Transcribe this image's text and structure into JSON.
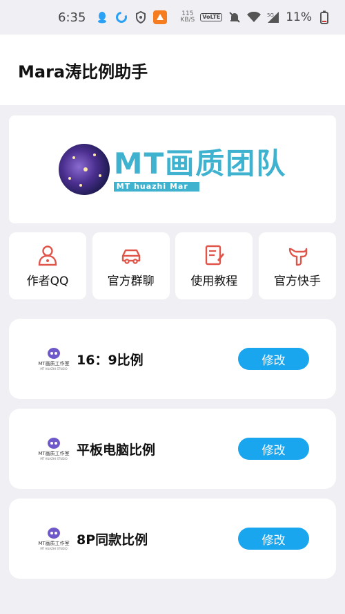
{
  "status_bar": {
    "time": "6:35",
    "net_speed_value": "115",
    "net_speed_unit": "KB/S",
    "volte_label": "VoLTE",
    "network_label": "5G",
    "battery": "11%"
  },
  "header": {
    "title": "Mara涛比例助手"
  },
  "banner": {
    "brand": "MT画质团队",
    "subtitle": "MT huazhi Mar"
  },
  "actions": [
    {
      "label": "作者QQ",
      "icon": "user-icon"
    },
    {
      "label": "官方群聊",
      "icon": "car-icon"
    },
    {
      "label": "使用教程",
      "icon": "document-icon"
    },
    {
      "label": "官方快手",
      "icon": "kuaishou-icon"
    }
  ],
  "cards": [
    {
      "title": "16：9比例",
      "button": "修改",
      "studio_name": "MT画质工作室",
      "studio_tagline": "MT HUAZHI STUDIO"
    },
    {
      "title": "平板电脑比例",
      "button": "修改",
      "studio_name": "MT画质工作室",
      "studio_tagline": "MT HUAZHI STUDIO"
    },
    {
      "title": "8P同款比例",
      "button": "修改",
      "studio_name": "MT画质工作室",
      "studio_tagline": "MT HUAZHI STUDIO"
    }
  ],
  "colors": {
    "accent_button": "#1aa6ef",
    "icon_red": "#e0554a",
    "brand_teal": "#3fb2cf",
    "background": "#efeff4"
  }
}
